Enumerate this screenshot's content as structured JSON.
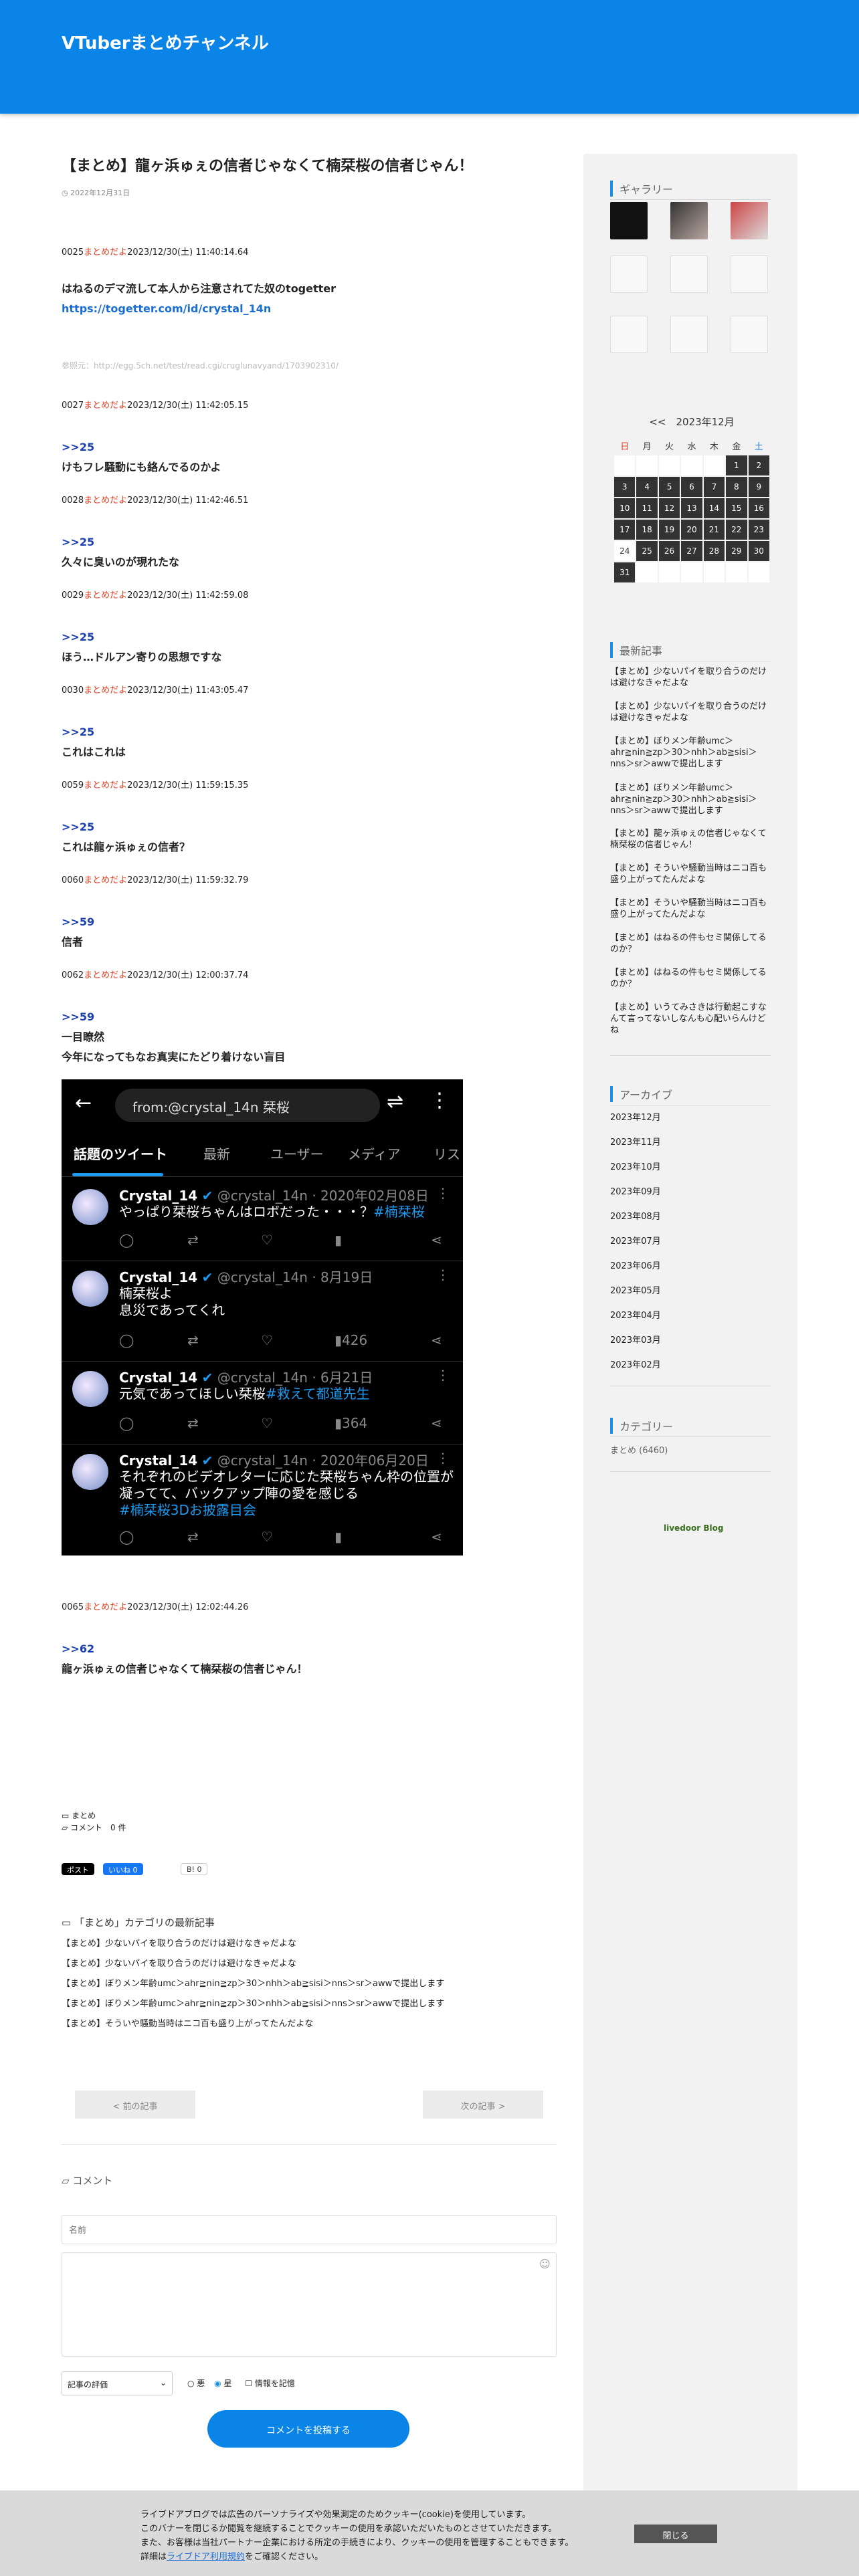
{
  "site": {
    "title": "VTuberまとめチャンネル"
  },
  "article": {
    "title": "【まとめ】龍ヶ浜ゅぇの信者じゃなくて楠栞桜の信者じゃん！",
    "date": "2022年12月31日"
  },
  "posts": [
    {
      "num": "0025",
      "name": "まとめだよ",
      "date": "2023/12/30(土) 11:40:14.64",
      "anchor": "",
      "lines": [
        "はねるのデマ流して本人から注意されてた奴のtogetter"
      ],
      "link": "https://togetter.com/id/crystal_14n"
    },
    {
      "num": "0027",
      "name": "まとめだよ",
      "date": "2023/12/30(土) 11:42:05.15",
      "anchor": ">>25",
      "lines": [
        "けもフレ騒動にも絡んでるのかよ"
      ]
    },
    {
      "num": "0028",
      "name": "まとめだよ",
      "date": "2023/12/30(土) 11:42:46.51",
      "anchor": ">>25",
      "lines": [
        "久々に臭いのが現れたな"
      ]
    },
    {
      "num": "0029",
      "name": "まとめだよ",
      "date": "2023/12/30(土) 11:42:59.08",
      "anchor": ">>25",
      "lines": [
        "ほう…ドルアン寄りの思想ですな"
      ]
    },
    {
      "num": "0030",
      "name": "まとめだよ",
      "date": "2023/12/30(土) 11:43:05.47",
      "anchor": ">>25",
      "lines": [
        "これはこれは"
      ]
    },
    {
      "num": "0059",
      "name": "まとめだよ",
      "date": "2023/12/30(土) 11:59:15.35",
      "anchor": ">>25",
      "lines": [
        "これは龍ヶ浜ゅぇの信者？"
      ]
    },
    {
      "num": "0060",
      "name": "まとめだよ",
      "date": "2023/12/30(土) 11:59:32.79",
      "anchor": ">>59",
      "lines": [
        "信者"
      ]
    },
    {
      "num": "0062",
      "name": "まとめだよ",
      "date": "2023/12/30(土) 12:00:37.74",
      "anchor": ">>59",
      "lines": [
        "一目瞭然",
        "今年になってもなお真実にたどり着けない盲目"
      ]
    },
    {
      "num": "0065",
      "name": "まとめだよ",
      "date": "2023/12/30(土) 12:02:44.26",
      "anchor": ">>62",
      "lines": [
        "龍ヶ浜ゅぇの信者じゃなくて楠栞桜の信者じゃん！"
      ]
    }
  ],
  "reference": "参照元：http://egg.5ch.net/test/read.cgi/cruglunavyand/1703902310/",
  "screenshot": {
    "search": "from:@crystal_14n 栞桜",
    "tabs": [
      "話題のツイート",
      "最新",
      "ユーザー",
      "メディア",
      "リス"
    ],
    "tweets": [
      {
        "name": "Crystal_14",
        "handle": "@crystal_14n · 2020年02月08日",
        "text": "やっぱり栞桜ちゃんはロボだった・・・？",
        "tag": "#楠栞桜",
        "views": ""
      },
      {
        "name": "Crystal_14",
        "handle": "@crystal_14n · 8月19日",
        "text": "楠栞桜よ",
        "text2": "息災であってくれ",
        "tag": "",
        "views": "426"
      },
      {
        "name": "Crystal_14",
        "handle": "@crystal_14n · 6月21日",
        "text": "元気であってほしい栞桜",
        "tag": "#救えて都道先生",
        "views": "364"
      },
      {
        "name": "Crystal_14",
        "handle": "@crystal_14n · 2020年06月20日",
        "text": "それぞれのビデオレターに応じた栞桜ちゃん枠の位置が凝ってて、バックアップ陣の愛を感じる",
        "tag": "#楠栞桜3Dお披露目会",
        "views": ""
      }
    ]
  },
  "tags": {
    "category": "まとめ",
    "comments": "コメント　0 件"
  },
  "share": {
    "x": "ポスト",
    "fb": "いいね 0",
    "hatena": "B! 0"
  },
  "catlatest": {
    "heading": "「まとめ」カテゴリの最新記事",
    "items": [
      "【まとめ】少ないパイを取り合うのだけは避けなきゃだよな",
      "【まとめ】少ないパイを取り合うのだけは避けなきゃだよな",
      "【まとめ】ぼりメン年齢umc＞ahr≧nin≧zp＞30＞nhh＞ab≧sisi＞nns＞sr＞awwで提出します",
      "【まとめ】ぼりメン年齢umc＞ahr≧nin≧zp＞30＞nhh＞ab≧sisi＞nns＞sr＞awwで提出します",
      "【まとめ】そういや騒動当時はニコ百も盛り上がってたんだよな"
    ]
  },
  "nav": {
    "prev": "< 前の記事",
    "next": "次の記事 >"
  },
  "comment": {
    "heading": "コメント",
    "name_placeholder": "名前",
    "rating": "記事の評価",
    "rate_bad": "悪",
    "rate_good": "星",
    "remember": "情報を記憶",
    "submit": "コメントを投稿する"
  },
  "sidebar": {
    "gallery_title": "ギャラリー",
    "calendar": {
      "prev": "<<",
      "month": "2023年12月",
      "dows": [
        "日",
        "月",
        "火",
        "水",
        "木",
        "金",
        "土"
      ],
      "weeks": [
        [
          "",
          "",
          "",
          "",
          "",
          "1",
          "2"
        ],
        [
          "3",
          "4",
          "5",
          "6",
          "7",
          "8",
          "9"
        ],
        [
          "10",
          "11",
          "12",
          "13",
          "14",
          "15",
          "16"
        ],
        [
          "17",
          "18",
          "19",
          "20",
          "21",
          "22",
          "23"
        ],
        [
          "24",
          "25",
          "26",
          "27",
          "28",
          "29",
          "30"
        ],
        [
          "31",
          "",
          "",
          "",
          "",
          "",
          ""
        ]
      ]
    },
    "recent_title": "最新記事",
    "recent": [
      "【まとめ】少ないパイを取り合うのだけは避けなきゃだよな",
      "【まとめ】少ないパイを取り合うのだけは避けなきゃだよな",
      "【まとめ】ぼりメン年齢umc＞ahr≧nin≧zp＞30＞nhh＞ab≧sisi＞nns＞sr＞awwで提出します",
      "【まとめ】ぼりメン年齢umc＞ahr≧nin≧zp＞30＞nhh＞ab≧sisi＞nns＞sr＞awwで提出します",
      "【まとめ】龍ヶ浜ゅぇの信者じゃなくて楠栞桜の信者じゃん！",
      "【まとめ】そういや騒動当時はニコ百も盛り上がってたんだよな",
      "【まとめ】そういや騒動当時はニコ百も盛り上がってたんだよな",
      "【まとめ】はねるの件もセミ関係してるのか？",
      "【まとめ】はねるの件もセミ関係してるのか？",
      "【まとめ】いうてみさきは行動起こすなんて言ってないしなんも心配いらんけどね"
    ],
    "archive_title": "アーカイブ",
    "archives": [
      "2023年12月",
      "2023年11月",
      "2023年10月",
      "2023年09月",
      "2023年08月",
      "2023年07月",
      "2023年06月",
      "2023年05月",
      "2023年04月",
      "2023年03月",
      "2023年02月"
    ],
    "category_title": "カテゴリー",
    "category": "まとめ (6460)",
    "livedoor": "livedoor Blog"
  },
  "cookie": {
    "line1": "ライブドアブログでは広告のパーソナライズや効果測定のためクッキー(cookie)を使用しています。",
    "line2": "このバナーを閉じるか閲覧を継続することでクッキーの使用を承認いただいたものとさせていただきます。",
    "line3": "また、お客様は当社パートナー企業における所定の手続きにより、クッキーの使用を管理することもできます。",
    "line4_pre": "詳細は",
    "line4_link": "ライブドア利用規約",
    "line4_post": "をご確認ください。",
    "close": "閉じる"
  },
  "colors": {
    "header": "#0a84e6",
    "accent": "#1a8de6",
    "name": "#e53a1e",
    "anchor": "#1a3fb0"
  }
}
